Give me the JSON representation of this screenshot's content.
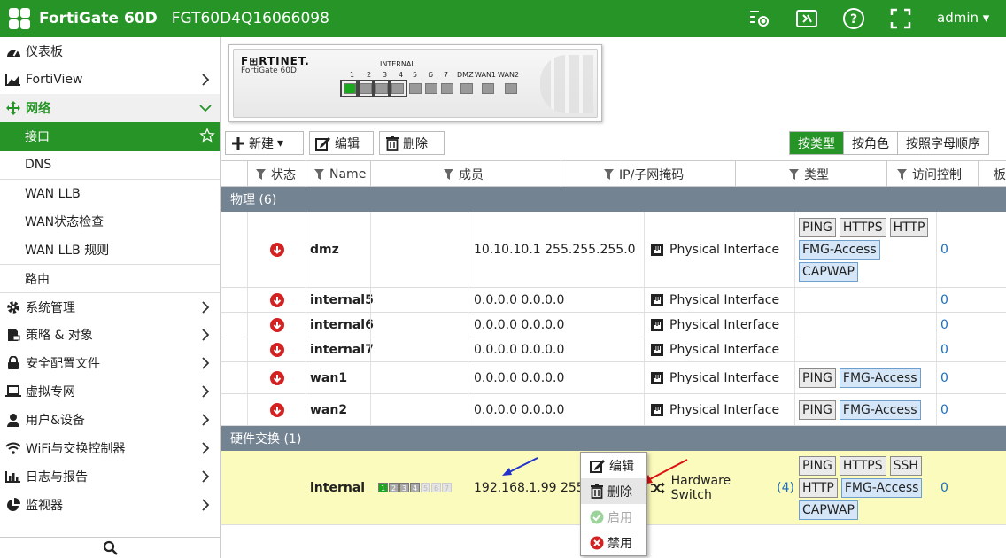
{
  "header": {
    "product": "FortiGate 60D",
    "serial": "FGT60D4Q16066098",
    "user": "admin"
  },
  "sidebar": {
    "items": [
      {
        "label": "仪表板",
        "icon": "dashboard-icon"
      },
      {
        "label": "FortiView",
        "icon": "fortiview-icon"
      },
      {
        "label": "网络",
        "icon": "network-icon"
      },
      {
        "label": "系统管理",
        "icon": "gear-icon"
      },
      {
        "label": "策略 & 对象",
        "icon": "policy-icon"
      },
      {
        "label": "安全配置文件",
        "icon": "lock-icon"
      },
      {
        "label": "虚拟专网",
        "icon": "laptop-icon"
      },
      {
        "label": "用户&设备",
        "icon": "user-icon"
      },
      {
        "label": "WiFi与交换控制器",
        "icon": "wifi-icon"
      },
      {
        "label": "日志与报告",
        "icon": "bar-chart-icon"
      },
      {
        "label": "监视器",
        "icon": "pie-chart-icon"
      }
    ],
    "network_sub": [
      "接口",
      "DNS",
      "WAN LLB",
      "WAN状态检查",
      "WAN LLB 规则",
      "路由"
    ]
  },
  "device": {
    "brand": "F⊞RTINET.",
    "model": "FortiGate 60D",
    "group_label": "INTERNAL",
    "port_labels": [
      "1",
      "2",
      "3",
      "4",
      "5",
      "6",
      "7",
      "DMZ",
      "WAN1",
      "WAN2"
    ]
  },
  "toolbar": {
    "new": "新建",
    "edit": "编辑",
    "delete": "删除",
    "views": [
      "按类型",
      "按角色",
      "按照字母顺序"
    ]
  },
  "table": {
    "headers": [
      "状态",
      "Name",
      "成员",
      "IP/子网掩码",
      "类型",
      "访问控制",
      "板"
    ],
    "groups": {
      "physical": "物理 (6)",
      "hw_switch": "硬件交换 (1)"
    },
    "rows": [
      {
        "name": "dmz",
        "ip": "10.10.10.1 255.255.255.0",
        "type": "Physical Interface",
        "tags": [
          "PING",
          "HTTPS",
          "HTTP",
          "FMG-Access",
          "CAPWAP"
        ],
        "ref": "0"
      },
      {
        "name": "internal5",
        "ip": "0.0.0.0 0.0.0.0",
        "type": "Physical Interface",
        "tags": [],
        "ref": "0"
      },
      {
        "name": "internal6",
        "ip": "0.0.0.0 0.0.0.0",
        "type": "Physical Interface",
        "tags": [],
        "ref": "0"
      },
      {
        "name": "internal7",
        "ip": "0.0.0.0 0.0.0.0",
        "type": "Physical Interface",
        "tags": [],
        "ref": "0"
      },
      {
        "name": "wan1",
        "ip": "0.0.0.0 0.0.0.0",
        "type": "Physical Interface",
        "tags": [
          "PING",
          "FMG-Access"
        ],
        "ref": "0"
      },
      {
        "name": "wan2",
        "ip": "0.0.0.0 0.0.0.0",
        "type": "Physical Interface",
        "tags": [
          "PING",
          "FMG-Access"
        ],
        "ref": "0"
      }
    ],
    "switch_row": {
      "name": "internal",
      "members": [
        "1",
        "2",
        "3",
        "4",
        "5",
        "6",
        "7"
      ],
      "ip": "192.168.1.99 255.",
      "type": "Hardware Switch",
      "count": "(4)",
      "tags": [
        "PING",
        "HTTPS",
        "SSH",
        "HTTP",
        "FMG-Access",
        "CAPWAP"
      ],
      "ref": "0"
    }
  },
  "context_menu": {
    "items": [
      "编辑",
      "删除",
      "启用",
      "禁用"
    ]
  }
}
